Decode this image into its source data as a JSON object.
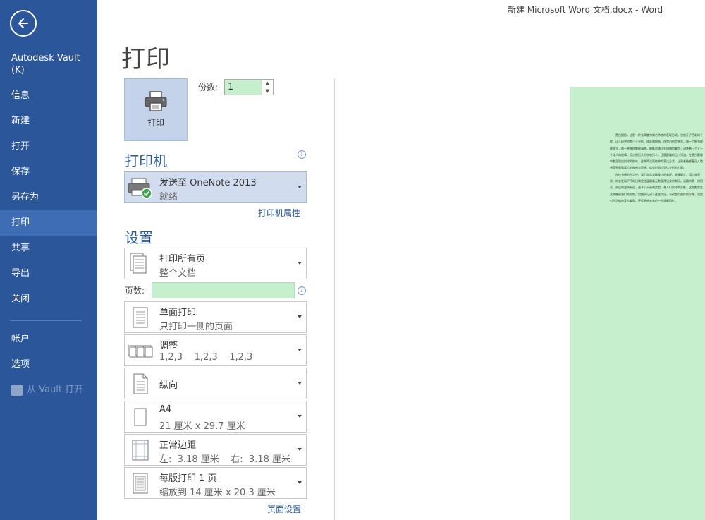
{
  "window": {
    "title": "新建 Microsoft Word 文档.docx - Word"
  },
  "sidebar": {
    "vault_title": "Autodesk Vault (K)",
    "items": [
      {
        "label": "信息"
      },
      {
        "label": "新建"
      },
      {
        "label": "打开"
      },
      {
        "label": "保存"
      },
      {
        "label": "另存为"
      },
      {
        "label": "打印",
        "active": true
      },
      {
        "label": "共享"
      },
      {
        "label": "导出"
      },
      {
        "label": "关闭"
      }
    ],
    "bottom_items": [
      {
        "label": "帐户"
      },
      {
        "label": "选项"
      },
      {
        "label": "从 Vault 打开",
        "disabled": true
      }
    ]
  },
  "print": {
    "heading": "打印",
    "button_label": "打印",
    "copies_label": "份数:",
    "copies_value": "1"
  },
  "printer": {
    "heading": "打印机",
    "name": "发送至 OneNote 2013",
    "status": "就绪",
    "properties_link": "打印机属性"
  },
  "settings": {
    "heading": "设置",
    "pages_label": "页数:",
    "pages_value": "",
    "dropdowns": [
      {
        "main": "打印所有页",
        "sub": "整个文档",
        "icon": "pages-icon"
      },
      {
        "main": "单面打印",
        "sub": "只打印一侧的页面",
        "icon": "one-sided-icon"
      },
      {
        "main": "调整",
        "sub": "1,2,3    1,2,3    1,2,3",
        "icon": "collate-icon"
      },
      {
        "main": "纵向",
        "sub": "",
        "icon": "portrait-icon"
      },
      {
        "main": "A4",
        "sub": "21 厘米 x 29.7 厘米",
        "icon": "paper-size-icon"
      },
      {
        "main": "正常边距",
        "sub": "左:  3.18 厘米    右:  3.18 厘米",
        "icon": "margins-icon"
      },
      {
        "main": "每版打印 1 页",
        "sub": "缩放到 14 厘米 x 20.3 厘米",
        "icon": "pages-per-sheet-icon"
      }
    ],
    "page_setup_link": "页面设置"
  },
  "preview": {
    "paragraphs": [
      "黑白摄影，这是一种充满魅力和艺术感的表现形式，它抛开了色彩的干扰，让人们更加专注于光影、线条和构图。在黑白的世界里，每一个细节都被放大，每一种情绪都被凝练。摄影师通过对明暗的掌控，讲述着一个又一个动人的故事。无论是街头的匆匆行人，还是静谧的山川河流，在黑白影像中都呈现出别样的韵味。这种简洁而纯粹的表达方式，让观者能够更深入地感受到画面背后的情感与思想，体会时间与记忆交织的力量。",
      "在快节奏的生活中，我们常常忽略身边的美好。放慢脚步，用心去观察，你会发现平凡的日常里也蕴藏着无数值得记录的瞬间。清晨的第一缕阳光，雨后的湿润街道，孩子们天真的笑脸，老人们安详的身影，这些都是生活馈赠给我们的礼物。用镜头记录下这些片段，不仅是对美好的珍藏，也是对生活的热爱与尊重，更是留给未来的一份温暖回忆。"
    ]
  }
}
